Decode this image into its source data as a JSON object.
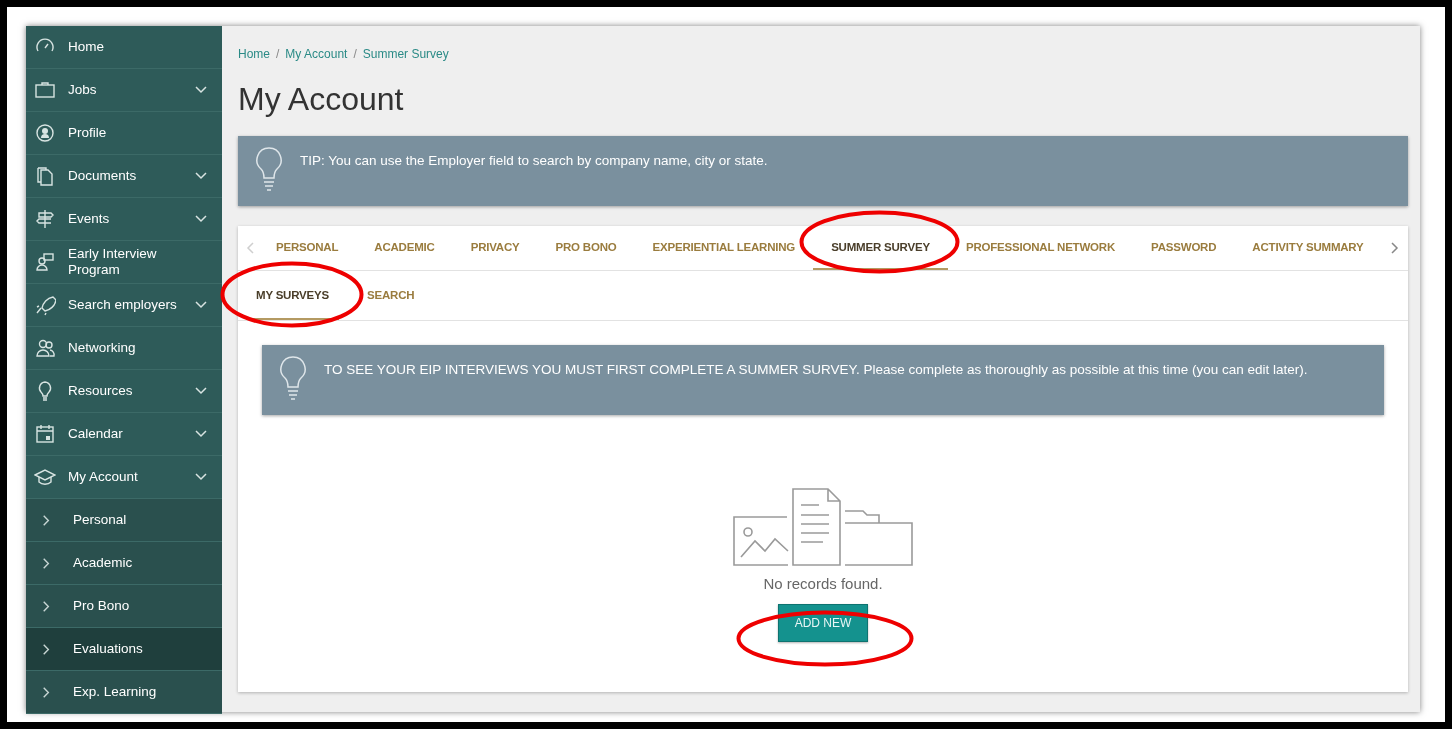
{
  "sidebar": {
    "items": [
      {
        "label": "Home",
        "expandable": false
      },
      {
        "label": "Jobs",
        "expandable": true
      },
      {
        "label": "Profile",
        "expandable": false
      },
      {
        "label": "Documents",
        "expandable": true
      },
      {
        "label": "Events",
        "expandable": true
      },
      {
        "label": "Early Interview Program",
        "expandable": false
      },
      {
        "label": "Search employers",
        "expandable": true
      },
      {
        "label": "Networking",
        "expandable": false
      },
      {
        "label": "Resources",
        "expandable": true
      },
      {
        "label": "Calendar",
        "expandable": true
      },
      {
        "label": "My Account",
        "expandable": true,
        "children": [
          {
            "label": "Personal",
            "selected": false
          },
          {
            "label": "Academic",
            "selected": false
          },
          {
            "label": "Pro Bono",
            "selected": false
          },
          {
            "label": "Evaluations",
            "selected": true
          },
          {
            "label": "Exp. Learning",
            "selected": false
          }
        ]
      }
    ]
  },
  "breadcrumb": [
    "Home",
    "My Account",
    "Summer Survey"
  ],
  "breadcrumb_separator": "/",
  "page_title": "My Account",
  "tip": "TIP: You can use the Employer field to search by company name, city or state.",
  "tabs": [
    {
      "label": "PERSONAL",
      "selected": false
    },
    {
      "label": "ACADEMIC",
      "selected": false
    },
    {
      "label": "PRIVACY",
      "selected": false
    },
    {
      "label": "PRO BONO",
      "selected": false
    },
    {
      "label": "EXPERIENTIAL LEARNING",
      "selected": false
    },
    {
      "label": "SUMMER SURVEY",
      "selected": true
    },
    {
      "label": "PROFESSIONAL NETWORK",
      "selected": false
    },
    {
      "label": "PASSWORD",
      "selected": false
    },
    {
      "label": "ACTIVITY SUMMARY",
      "selected": false
    }
  ],
  "subtabs": [
    {
      "label": "MY SURVEYS",
      "selected": true
    },
    {
      "label": "SEARCH",
      "selected": false
    }
  ],
  "notice": "TO SEE YOUR EIP INTERVIEWS YOU MUST FIRST COMPLETE A SUMMER SURVEY. Please complete as thoroughly as possible at this time (you can edit later).",
  "empty_state": {
    "message": "No records found.",
    "button": "ADD NEW"
  }
}
